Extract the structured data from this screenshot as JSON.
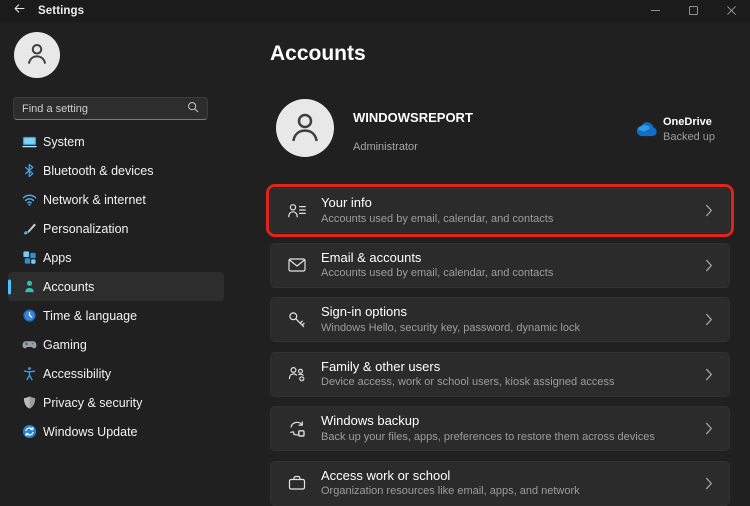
{
  "titlebar": {
    "title": "Settings",
    "icons": [
      "back-arrow-icon",
      "minimize-icon",
      "maximize-icon",
      "close-icon"
    ]
  },
  "sidebar": {
    "avatar_icon": "user-avatar-icon",
    "search_placeholder": "Find a setting",
    "search_icon": "search-icon",
    "items": [
      {
        "label": "System",
        "icon": "system-icon",
        "selected": false
      },
      {
        "label": "Bluetooth & devices",
        "icon": "bluetooth-icon",
        "selected": false
      },
      {
        "label": "Network & internet",
        "icon": "network-icon",
        "selected": false
      },
      {
        "label": "Personalization",
        "icon": "personalization-icon",
        "selected": false
      },
      {
        "label": "Apps",
        "icon": "apps-icon",
        "selected": false
      },
      {
        "label": "Accounts",
        "icon": "accounts-icon",
        "selected": true
      },
      {
        "label": "Time & language",
        "icon": "time-language-icon",
        "selected": false
      },
      {
        "label": "Gaming",
        "icon": "gaming-icon",
        "selected": false
      },
      {
        "label": "Accessibility",
        "icon": "accessibility-icon",
        "selected": false
      },
      {
        "label": "Privacy & security",
        "icon": "privacy-icon",
        "selected": false
      },
      {
        "label": "Windows Update",
        "icon": "windows-update-icon",
        "selected": false
      }
    ]
  },
  "main": {
    "heading": "Accounts",
    "profile": {
      "name": "WINDOWSREPORT",
      "role": "Administrator",
      "avatar_icon": "user-avatar-icon"
    },
    "onedrive": {
      "title": "OneDrive",
      "status": "Backed up",
      "icon": "onedrive-cloud-icon"
    },
    "cards": [
      {
        "title": "Your info",
        "description": "Accounts used by email, calendar, and contacts",
        "icon": "your-info-icon",
        "highlighted": true
      },
      {
        "title": "Email & accounts",
        "description": "Accounts used by email, calendar, and contacts",
        "icon": "email-icon",
        "highlighted": false
      },
      {
        "title": "Sign-in options",
        "description": "Windows Hello, security key, password, dynamic lock",
        "icon": "signin-key-icon",
        "highlighted": false
      },
      {
        "title": "Family & other users",
        "description": "Device access, work or school users, kiosk assigned access",
        "icon": "family-icon",
        "highlighted": false
      },
      {
        "title": "Windows backup",
        "description": "Back up your files, apps, preferences to restore them across devices",
        "icon": "backup-icon",
        "highlighted": false
      },
      {
        "title": "Access work or school",
        "description": "Organization resources like email, apps, and network",
        "icon": "briefcase-icon",
        "highlighted": false
      }
    ]
  },
  "colors": {
    "accent": "#4cc2ff",
    "highlight_red": "#e1251c",
    "card_background": "#2b2b2b",
    "window_background": "#202020"
  }
}
